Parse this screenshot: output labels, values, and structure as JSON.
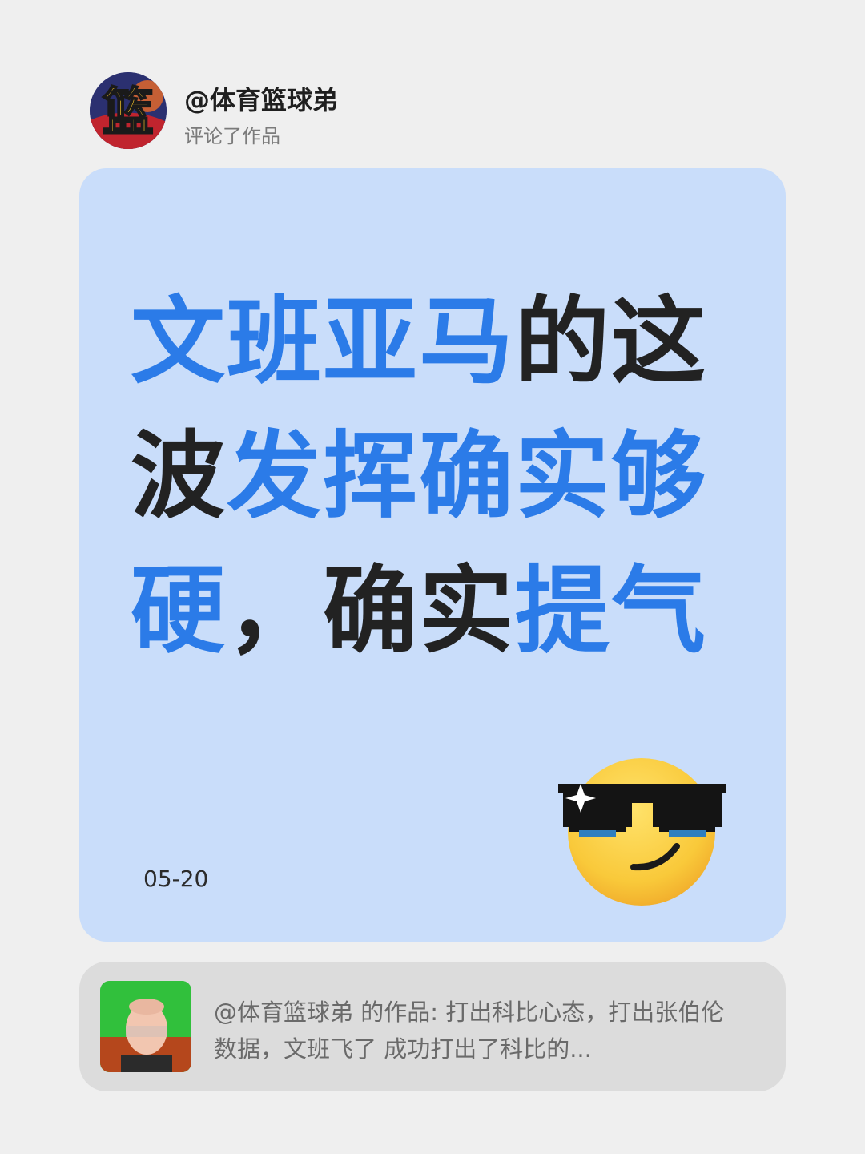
{
  "header": {
    "username": "@体育篮球弟",
    "action": "评论了作品",
    "avatar_glyph": "篮"
  },
  "comment": {
    "segments": [
      {
        "text": "文班亚马",
        "highlight": true
      },
      {
        "text": "的这\n波",
        "highlight": false
      },
      {
        "text": "发挥确实够\n硬",
        "highlight": true
      },
      {
        "text": "，确实",
        "highlight": false
      },
      {
        "text": "提气",
        "highlight": true
      }
    ],
    "date": "05-20",
    "emoji": "smiling-face-with-sunglasses"
  },
  "referenced_work": {
    "description": "@体育篮球弟 的作品: 打出科比心态，打出张伯伦数据，文班飞了 成功打出了科比的..."
  },
  "colors": {
    "background": "#efefef",
    "card": "#c9ddfa",
    "highlight": "#2b7be8",
    "text_dark": "#222222",
    "work_card": "#dcdcdc"
  }
}
